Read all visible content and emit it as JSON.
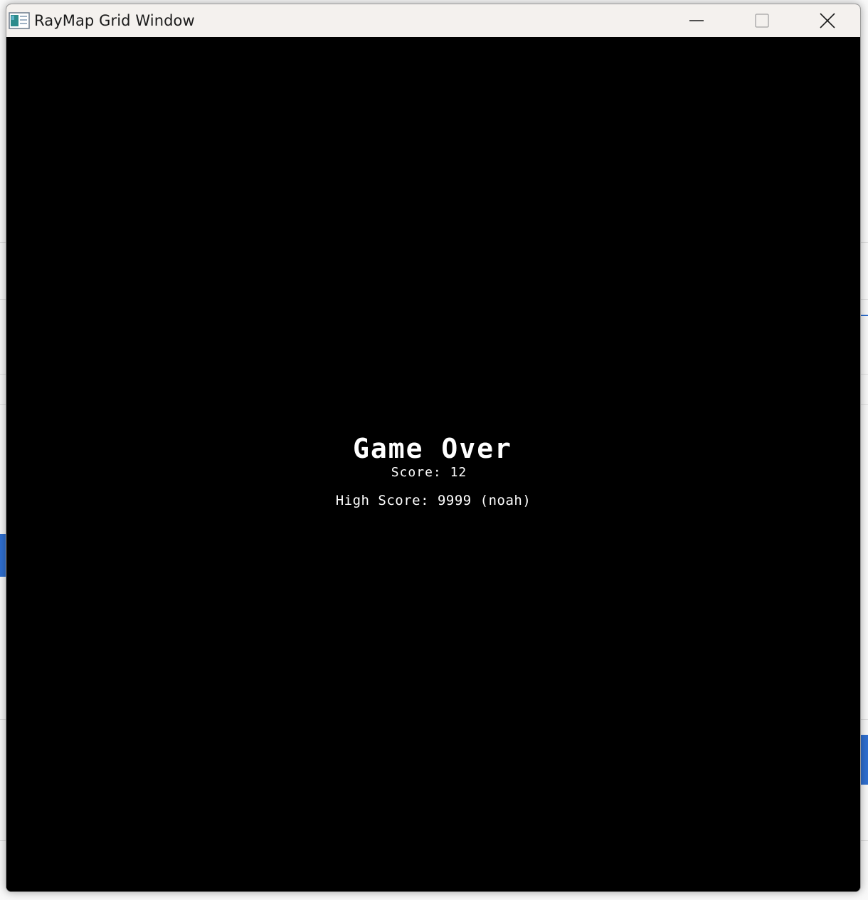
{
  "window": {
    "title": "RayMap Grid Window",
    "icon": "app-window-icon",
    "controls": {
      "minimize": "minimize-icon",
      "maximize": "maximize-icon",
      "close": "close-icon"
    }
  },
  "game": {
    "background_color": "#000000",
    "text_color": "#ffffff",
    "heading": "Game Over",
    "score_text": "Score: 12",
    "high_score_text": "High Score: 9999 (noah)"
  }
}
